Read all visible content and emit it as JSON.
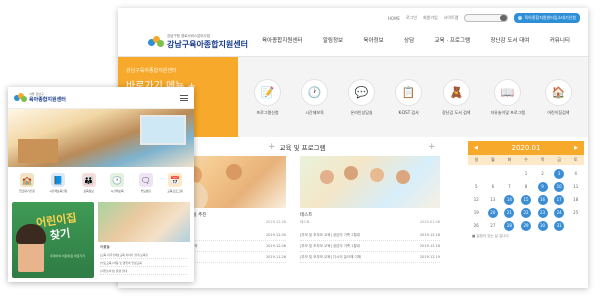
{
  "desktop": {
    "util_links": [
      "HOME",
      "로그인",
      "회원가입",
      "사이트맵"
    ],
    "cta_label": "육아종합지원센터입소대기신청",
    "logo_line1": "강남구청 경로서비스분야사업",
    "logo_line2": "강남구육아종합지원센터",
    "nav": [
      "육아종합지원센터",
      "알림정보",
      "육아정보",
      "상담",
      "교육 · 프로그램",
      "장난감 도서 대여",
      "커뮤니티"
    ],
    "quick": {
      "small": "강남구육아종합지원센터",
      "big": "바로가기 메뉴 +",
      "note": "강남구육아종합지원센터 바로가기"
    },
    "icons": [
      {
        "label": "프로그램신청",
        "glyph": "📝"
      },
      {
        "label": "시간제보육",
        "glyph": "🕐"
      },
      {
        "label": "온라인상담실",
        "glyph": "💬"
      },
      {
        "label": "K-DST 검사",
        "glyph": "📋"
      },
      {
        "label": "장난감 도서 검색",
        "glyph": "🧸"
      },
      {
        "label": "자유놀이및 프로그램",
        "glyph": "📖"
      },
      {
        "label": "어린이집검색",
        "glyph": "🏠"
      }
    ],
    "section_title": "교육 및 프로그램",
    "cards": [
      {
        "title": "[교육정보] 1월 자유놀이실 추진",
        "sub": "2020년 1월 자유놀이실 추진",
        "date": "2019.12.26"
      },
      {
        "title": "테스트",
        "sub": "테스트",
        "date": "2020.01.06"
      }
    ],
    "list_left": [
      {
        "text": "강남구 인터넷학부모교육 12월",
        "date": "2019.12.05"
      },
      {
        "text": "[프로그램] 2019년 12월 안전교육",
        "date": "2019.12.06"
      },
      {
        "text": "[부모교육] 영유아 놀이 관련",
        "date": "2019.11.26"
      }
    ],
    "list_right": [
      {
        "text": "[부모 및 조부모 교육] 공감의 가족 2월대",
        "date": "2019.12.18"
      },
      {
        "text": "[부모 및 조부모 교육] 공감의 가족 1월대",
        "date": "2019.12.18"
      },
      {
        "text": "[부모 및 조부모 교육] 다시의 놀이해 이해",
        "date": "2019.12.19"
      }
    ],
    "calendar": {
      "month": "2020.01",
      "weekdays": [
        "일",
        "월",
        "화",
        "수",
        "목",
        "금",
        "토"
      ],
      "blanks": 3,
      "days": [
        "1",
        "2",
        "3",
        "4",
        "5",
        "6",
        "7",
        "8",
        "9",
        "10",
        "11",
        "12",
        "13",
        "14",
        "15",
        "16",
        "17",
        "18",
        "19",
        "20",
        "21",
        "22",
        "23",
        "24",
        "25",
        "26",
        "27",
        "28",
        "29",
        "30",
        "31"
      ],
      "event_days": [
        "3",
        "9",
        "10",
        "14",
        "15",
        "16",
        "17",
        "20",
        "21",
        "22",
        "23",
        "24",
        "28",
        "29",
        "30",
        "31"
      ],
      "note": "■ 일정이 있는 날 입니다"
    }
  },
  "mobile": {
    "logo_line1": "서울 강남구",
    "logo_line2": "육아종합지원센터",
    "icons": [
      {
        "label": "입소대기신청",
        "glyph": "🏫",
        "color": "#f3e2c6"
      },
      {
        "label": "시간제보육신청",
        "glyph": "📘",
        "color": "#dbe9f7"
      },
      {
        "label": "보육정보",
        "glyph": "👪",
        "color": "#f7dcdc"
      },
      {
        "label": "시간제보육",
        "glyph": "🕐",
        "color": "#e4f1dc"
      },
      {
        "label": "부모상담",
        "glyph": "🗨",
        "color": "#efe4f5"
      },
      {
        "label": "교육프로그램",
        "glyph": "📅",
        "color": "#fde9c7"
      }
    ],
    "banner_1": "어린이집",
    "banner_2": "찾기",
    "banner_sub": "우리아이 어린이집 바로가기",
    "notice_title": "어플들",
    "notices": [
      "[교육 미국경제][교육 이야기 쉽게 보육을",
      "[부모교육] 아동 및 영유아 인성교육",
      "[자유놀이실] 운영 안내"
    ]
  }
}
